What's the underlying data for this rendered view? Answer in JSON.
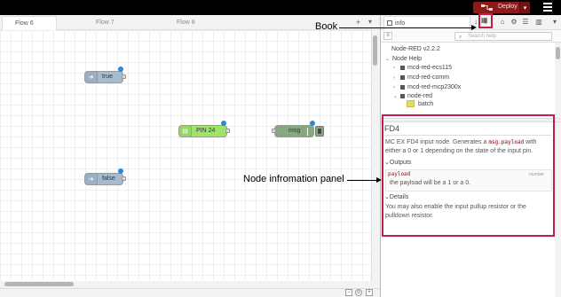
{
  "header": {
    "deploy_label": "Deploy",
    "deploy_caret": "▾",
    "accent": "#8c1a1a",
    "menu_icon": "hamburger-menu-icon"
  },
  "workspace": {
    "tabs": [
      {
        "label": "Flow 6",
        "active": true
      },
      {
        "label": "Flow 7",
        "active": false
      },
      {
        "label": "Flow 8",
        "active": false
      }
    ],
    "add_tab": "+",
    "tab_menu": "▾",
    "nodes": [
      {
        "label": "true",
        "color": "#a6bbcf"
      },
      {
        "label": "false",
        "color": "#a6bbcf"
      },
      {
        "label": "PIN 24",
        "color": "#9ee36a"
      },
      {
        "label": "msg",
        "color": "#87a980"
      }
    ],
    "zoom_controls": [
      "−",
      "o",
      "+"
    ]
  },
  "sidebar": {
    "tab_label": "info",
    "search_placeholder": "Search help",
    "buttons": [
      "i",
      "⚙",
      "☰",
      "▥"
    ],
    "book_icon": "book-icon",
    "version": "Node-RED v2.2.2",
    "tree": {
      "root": "Node Help",
      "items": [
        "mcd-red-ecs115",
        "mcd-red-comm",
        "mcd-red-mcp2300x",
        "node-red"
      ],
      "child": "batch"
    },
    "info": {
      "title": "FD4",
      "desc_prefix": "MC EX FD4 input node. Generates a",
      "desc_code": "msg.payload",
      "desc_suffix": "with either a 0 or 1 depending on the state of the input pin.",
      "outputs_heading": "Outputs",
      "output_name": "payload",
      "output_type": "number",
      "output_desc": "the payload will be a 1 or a 0.",
      "details_heading": "Details",
      "details_text": "You may also enable the input pullup resistor or the pulldown resistor."
    }
  },
  "annotations": {
    "book": "Book",
    "panel": "Node infromation panel",
    "color": "#c21e48"
  }
}
